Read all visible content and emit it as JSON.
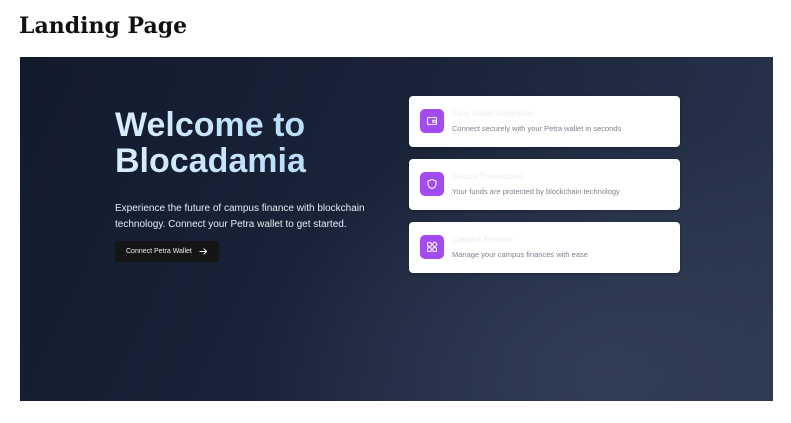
{
  "page": {
    "heading": "Landing Page"
  },
  "hero": {
    "title_line1": "Welcome to",
    "title_line2": "Blocadamia",
    "description": "Experience the future of campus finance with blockchain technology. Connect your Petra wallet to get started.",
    "cta_label": "Connect Petra Wallet",
    "cta_icon": "arrow-right-icon"
  },
  "features": [
    {
      "title": "Easy Wallet Integration",
      "description": "Connect securely with your Petra wallet in seconds",
      "icon": "wallet-icon"
    },
    {
      "title": "Secure Transactions",
      "description": "Your funds are protected by blockchain technology",
      "icon": "shield-icon"
    },
    {
      "title": "Campus Finance",
      "description": "Manage your campus finances with ease",
      "icon": "apps-grid-icon"
    }
  ],
  "colors": {
    "accent_purple": "#a14bf0",
    "hero_bg_dark": "#121a2c",
    "title_gradient_start": "#d9ecff",
    "title_gradient_end": "#a9d7fb",
    "button_bg": "#151515"
  }
}
